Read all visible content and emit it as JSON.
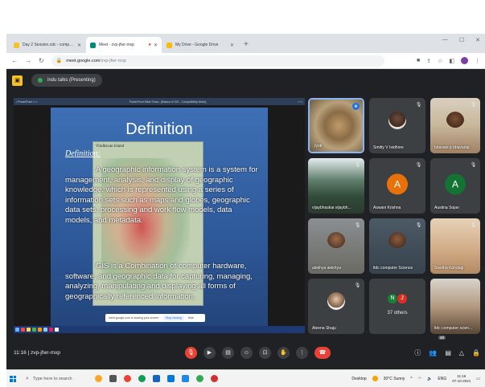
{
  "browser": {
    "tabs": [
      {
        "title": "Day 2 Session.cdc - computer",
        "color": "#f6c026",
        "active": false
      },
      {
        "title": "Meet - zvp-jfwr-mxp",
        "color": "#00897b",
        "active": true
      },
      {
        "title": "My Drive - Google Drive",
        "color": "#fbbc04",
        "active": false
      }
    ],
    "new_tab": "+",
    "url_host": "meet.google.com",
    "url_path": "/zvp-jfwr-mxp"
  },
  "meet": {
    "presenter_label": "indu talks (Presenting)",
    "meeting_time": "11:16",
    "meeting_code": "zvp-jfwr-mxp",
    "participant_badge": "48"
  },
  "slide": {
    "window_title": "PowerPoint Slide Show - [Basics of GIS - Compatibility Mode]",
    "map_label": "Vindhavan Island",
    "title": "Definition",
    "subtitle": "Definition:",
    "para1": "A geographic information system is a system for management, analysis, and display of geographic knowledge, which is represented using a series of information sets such as maps and globes, geographic data sets, processing and work flow models, data models, and metadata.",
    "para2": "GIS is a Combination of computer hardware, software, and geographic data for capturing, managing, analyzing, manipulating and displaying all forms of geographically referenced information.",
    "share_text": "meet.google.com is sharing your screen.",
    "share_stop": "Stop sharing",
    "share_hide": "Hide"
  },
  "participants": [
    {
      "name": "Jyoti",
      "kind": "photo"
    },
    {
      "name": "Smitty V Isidhore",
      "kind": "photo"
    },
    {
      "name": "bhavani p bhavanip",
      "kind": "photo"
    },
    {
      "name": "vijaybhaskar.vijaybh...",
      "kind": "photo"
    },
    {
      "name": "Aswani Krishna",
      "kind": "initial",
      "initial": "A",
      "color": "#e8710a"
    },
    {
      "name": "Austina Sojan",
      "kind": "initial",
      "initial": "A",
      "color": "#137333"
    },
    {
      "name": "alekhya alekhya",
      "kind": "photo"
    },
    {
      "name": "ltdc computer Science",
      "kind": "photo"
    },
    {
      "name": "Swetha Kondagi",
      "kind": "photo"
    },
    {
      "name": "Aleena Shaju",
      "kind": "photo"
    },
    {
      "name": "37 others",
      "kind": "others",
      "initials": [
        "N",
        "J"
      ]
    },
    {
      "name": "ltdc computer scien...",
      "kind": "photo"
    }
  ],
  "windows": {
    "search_placeholder": "Type here to search",
    "desktop_label": "Desktop",
    "weather": "30°C Sunny",
    "lang": "ENG",
    "time": "11:16",
    "date": "07-10-2021"
  }
}
